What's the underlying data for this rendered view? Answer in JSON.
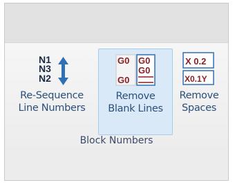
{
  "ribbon": {
    "group_label": "Block Numbers",
    "buttons": [
      {
        "line1": "Re-Sequence",
        "line2": "Line Numbers",
        "icon": "resequence-icon",
        "icon_text": [
          "N1",
          "N3",
          "N2"
        ],
        "selected": false
      },
      {
        "line1": "Remove",
        "line2": "Blank Lines",
        "icon": "remove-blank-lines-icon",
        "icon_text": [
          "G0",
          "G0",
          "G0",
          "G0"
        ],
        "selected": true
      },
      {
        "line1": "Remove",
        "line2": "Spaces",
        "icon": "remove-spaces-icon",
        "icon_text": [
          "X 0.2",
          "X0.1Y"
        ],
        "selected": false
      }
    ]
  },
  "colors": {
    "label": "#2a4f7a",
    "selected_bg": "#d9e9f8",
    "icon_red": "#8b1f24",
    "icon_blue": "#2f6fb6"
  }
}
